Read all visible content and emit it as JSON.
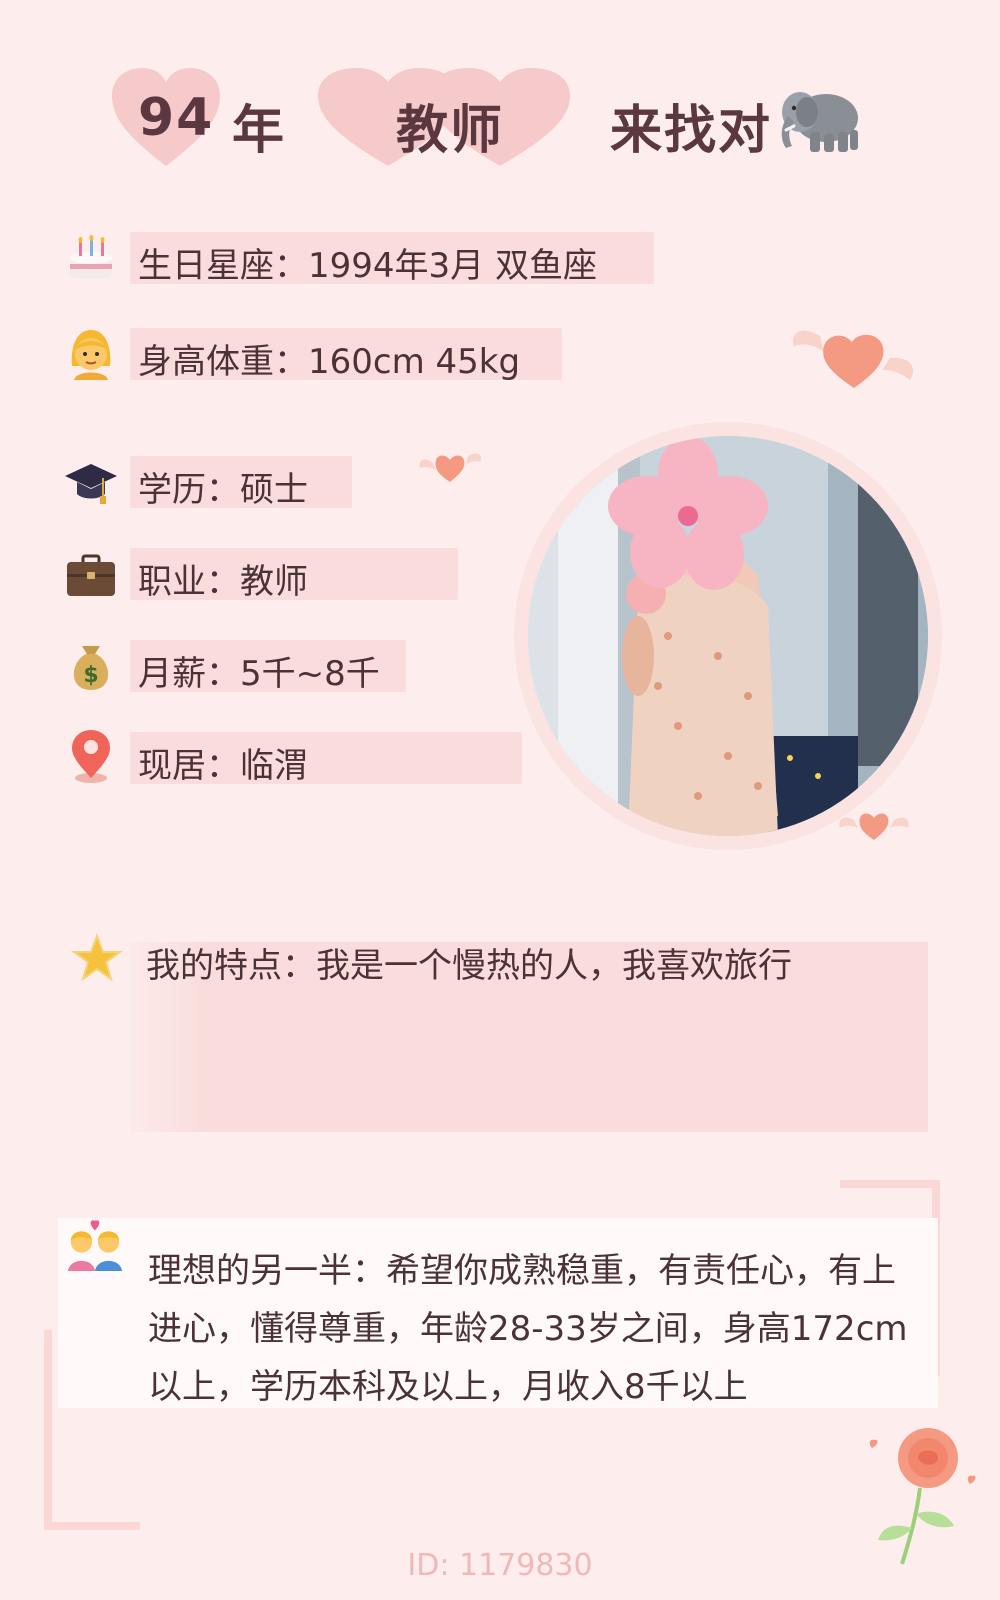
{
  "header": {
    "year_num": "94",
    "year_unit": "年",
    "job": "教师",
    "slogan": "来找对",
    "emoji": "🐘"
  },
  "info": {
    "birthday": {
      "icon": "birthday-cake-icon",
      "text": "生日星座：1994年3月 双鱼座"
    },
    "height_weight": {
      "icon": "woman-icon",
      "text": "身高体重：160cm 45kg"
    },
    "education": {
      "icon": "graduation-cap-icon",
      "text": "学历：硕士"
    },
    "occupation": {
      "icon": "briefcase-icon",
      "text": "职业：教师"
    },
    "salary": {
      "icon": "money-bag-icon",
      "text": "月薪：5千~8千"
    },
    "residence": {
      "icon": "location-pin-icon",
      "text": "现居：临渭"
    }
  },
  "traits": {
    "icon": "star-icon",
    "text": "我的特点：我是一个慢热的人，我喜欢旅行"
  },
  "ideal": {
    "icon": "couple-with-heart-icon",
    "text": "理想的另一半：希望你成熟稳重，有责任心，有上进心，懂得尊重，年龄28-33岁之间，身高172cm以上，学历本科及以上，月收入8千以上"
  },
  "footer": {
    "id": "ID: 1179830"
  },
  "colors": {
    "background": "#fdeeed",
    "bar": "#f9dcdb",
    "heart": "#f6c9ca",
    "title": "#5b3840"
  }
}
